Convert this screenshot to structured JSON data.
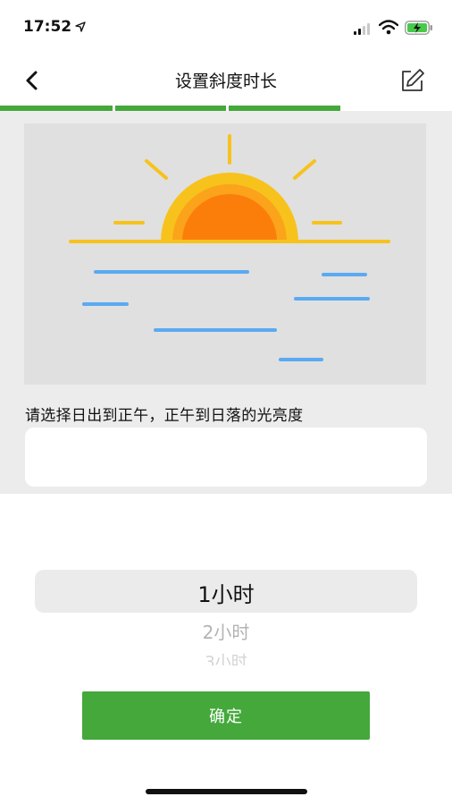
{
  "status": {
    "time": "17:52",
    "icons": [
      "location-arrow-icon",
      "signal-icon",
      "wifi-icon",
      "battery-charging-icon"
    ]
  },
  "nav": {
    "title": "设置斜度时长",
    "back_icon": "chevron-left-icon",
    "edit_icon": "edit-icon"
  },
  "progress": {
    "total_steps": 3,
    "completed_steps": 3,
    "color": "#44a83b"
  },
  "illustration": {
    "name": "sunrise-over-water",
    "colors": {
      "sun_outer": "#f7c21c",
      "sun_middle": "#fba31b",
      "sun_inner": "#fb7e0b",
      "horizon": "#f7c21c",
      "water": "#5aaaf2",
      "background": "#e0e0e0"
    }
  },
  "form": {
    "prompt": "请选择日出到正午，正午到日落的光亮度",
    "input_value": ""
  },
  "picker": {
    "options": [
      "1小时",
      "2小时",
      "3小时"
    ],
    "selected": "1小时"
  },
  "actions": {
    "confirm_label": "确定",
    "confirm_color": "#44a83b"
  }
}
